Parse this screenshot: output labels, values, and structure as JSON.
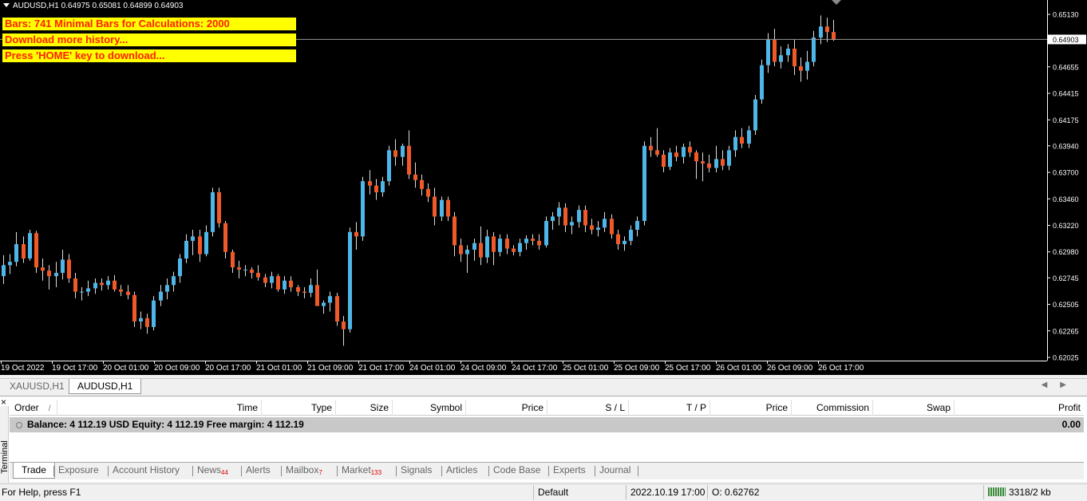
{
  "chart": {
    "symbol_line": "AUDUSD,H1  0.64975 0.65081 0.64899 0.64903",
    "warnings": [
      "Bars: 741   Minimal Bars for Calculations: 2000",
      "Download more history...",
      "Press 'HOME' key to download..."
    ],
    "current_price_label": "0.64903",
    "colors": {
      "background": "#000000",
      "bull": "#4fb6e8",
      "bear": "#f05a28",
      "text": "#ffffff",
      "warning_bg": "#ffff00",
      "warning_text": "#ff2000"
    }
  },
  "chart_data": {
    "type": "candlestick",
    "title": "",
    "price_ticks": [
      "0.65130",
      "0.64903",
      "0.64655",
      "0.64415",
      "0.64175",
      "0.63940",
      "0.63700",
      "0.63460",
      "0.63220",
      "0.62980",
      "0.62745",
      "0.62505",
      "0.62265",
      "0.62025"
    ],
    "time_ticks": [
      "19 Oct 2022",
      "19 Oct 17:00",
      "20 Oct 01:00",
      "20 Oct 09:00",
      "20 Oct 17:00",
      "21 Oct 01:00",
      "21 Oct 09:00",
      "21 Oct 17:00",
      "24 Oct 01:00",
      "24 Oct 09:00",
      "24 Oct 17:00",
      "25 Oct 01:00",
      "25 Oct 09:00",
      "25 Oct 17:00",
      "26 Oct 01:00",
      "26 Oct 09:00",
      "26 Oct 17:00"
    ],
    "ylim": [
      0.62025,
      0.652
    ],
    "candles": [
      [
        0.6276,
        0.6295,
        0.6269,
        0.6286
      ],
      [
        0.6286,
        0.6296,
        0.6278,
        0.6289
      ],
      [
        0.6289,
        0.6316,
        0.6285,
        0.6305
      ],
      [
        0.6305,
        0.6312,
        0.6288,
        0.6292
      ],
      [
        0.6292,
        0.6318,
        0.629,
        0.6315
      ],
      [
        0.6315,
        0.6317,
        0.6279,
        0.6284
      ],
      [
        0.6284,
        0.6292,
        0.6272,
        0.6281
      ],
      [
        0.6281,
        0.6286,
        0.6264,
        0.6276
      ],
      [
        0.6276,
        0.6289,
        0.6266,
        0.6279
      ],
      [
        0.6279,
        0.63,
        0.6273,
        0.6291
      ],
      [
        0.6291,
        0.6296,
        0.627,
        0.6274
      ],
      [
        0.6274,
        0.6279,
        0.6256,
        0.6262
      ],
      [
        0.6262,
        0.6266,
        0.6254,
        0.6262
      ],
      [
        0.6262,
        0.6272,
        0.6258,
        0.6265
      ],
      [
        0.6265,
        0.6274,
        0.626,
        0.627
      ],
      [
        0.627,
        0.6274,
        0.6263,
        0.6268
      ],
      [
        0.6268,
        0.6276,
        0.6264,
        0.6272
      ],
      [
        0.6272,
        0.6277,
        0.6262,
        0.6264
      ],
      [
        0.6264,
        0.6268,
        0.6258,
        0.6262
      ],
      [
        0.6262,
        0.6268,
        0.6255,
        0.6259
      ],
      [
        0.6259,
        0.6262,
        0.623,
        0.6235
      ],
      [
        0.6235,
        0.6244,
        0.6228,
        0.6238
      ],
      [
        0.6238,
        0.6242,
        0.6224,
        0.623
      ],
      [
        0.623,
        0.6258,
        0.6227,
        0.6254
      ],
      [
        0.6254,
        0.6268,
        0.6249,
        0.6262
      ],
      [
        0.6262,
        0.6274,
        0.6255,
        0.6268
      ],
      [
        0.6268,
        0.628,
        0.6262,
        0.6276
      ],
      [
        0.6276,
        0.6296,
        0.627,
        0.6292
      ],
      [
        0.6292,
        0.6314,
        0.6288,
        0.6308
      ],
      [
        0.6308,
        0.6318,
        0.6295,
        0.6312
      ],
      [
        0.6312,
        0.6318,
        0.6289,
        0.6296
      ],
      [
        0.6296,
        0.6322,
        0.6294,
        0.6316
      ],
      [
        0.6316,
        0.6356,
        0.6312,
        0.6352
      ],
      [
        0.6352,
        0.6356,
        0.632,
        0.6324
      ],
      [
        0.6324,
        0.6326,
        0.6292,
        0.6298
      ],
      [
        0.6298,
        0.63,
        0.6279,
        0.6284
      ],
      [
        0.6284,
        0.629,
        0.6274,
        0.6282
      ],
      [
        0.6282,
        0.6286,
        0.6276,
        0.6282
      ],
      [
        0.6282,
        0.6284,
        0.6274,
        0.6279
      ],
      [
        0.6279,
        0.6286,
        0.6272,
        0.6275
      ],
      [
        0.6275,
        0.6278,
        0.6266,
        0.627
      ],
      [
        0.627,
        0.628,
        0.6265,
        0.6276
      ],
      [
        0.6276,
        0.6278,
        0.6262,
        0.6264
      ],
      [
        0.6264,
        0.6276,
        0.626,
        0.6272
      ],
      [
        0.6272,
        0.6276,
        0.6262,
        0.6266
      ],
      [
        0.6266,
        0.6268,
        0.6258,
        0.6262
      ],
      [
        0.6262,
        0.6266,
        0.6256,
        0.6261
      ],
      [
        0.6261,
        0.6274,
        0.6257,
        0.6268
      ],
      [
        0.6268,
        0.6282,
        0.626,
        0.6249
      ],
      [
        0.6249,
        0.6254,
        0.6242,
        0.6252
      ],
      [
        0.6252,
        0.6262,
        0.6244,
        0.6258
      ],
      [
        0.6258,
        0.6261,
        0.6231,
        0.6235
      ],
      [
        0.6235,
        0.624,
        0.6213,
        0.6228
      ],
      [
        0.6228,
        0.632,
        0.6225,
        0.6316
      ],
      [
        0.6316,
        0.6325,
        0.63,
        0.6312
      ],
      [
        0.6312,
        0.6366,
        0.6308,
        0.6362
      ],
      [
        0.6362,
        0.6372,
        0.635,
        0.6358
      ],
      [
        0.6358,
        0.6364,
        0.6345,
        0.6352
      ],
      [
        0.6352,
        0.6366,
        0.6348,
        0.6362
      ],
      [
        0.6362,
        0.6394,
        0.6358,
        0.639
      ],
      [
        0.639,
        0.64,
        0.6376,
        0.6384
      ],
      [
        0.6384,
        0.6396,
        0.6376,
        0.6394
      ],
      [
        0.6394,
        0.6408,
        0.6364,
        0.6368
      ],
      [
        0.6368,
        0.6379,
        0.6356,
        0.6363
      ],
      [
        0.6363,
        0.6368,
        0.6349,
        0.6355
      ],
      [
        0.6355,
        0.636,
        0.6343,
        0.6348
      ],
      [
        0.6348,
        0.6356,
        0.6322,
        0.633
      ],
      [
        0.633,
        0.6348,
        0.6326,
        0.6345
      ],
      [
        0.6345,
        0.6348,
        0.6326,
        0.633
      ],
      [
        0.633,
        0.6334,
        0.6294,
        0.6304
      ],
      [
        0.6304,
        0.631,
        0.6289,
        0.6296
      ],
      [
        0.6296,
        0.6304,
        0.6279,
        0.63
      ],
      [
        0.63,
        0.631,
        0.629,
        0.6306
      ],
      [
        0.6306,
        0.6321,
        0.6286,
        0.6293
      ],
      [
        0.6293,
        0.6318,
        0.6288,
        0.6312
      ],
      [
        0.6312,
        0.6316,
        0.6286,
        0.6298
      ],
      [
        0.6298,
        0.6314,
        0.6294,
        0.631
      ],
      [
        0.631,
        0.6314,
        0.6296,
        0.6301
      ],
      [
        0.6301,
        0.6304,
        0.6295,
        0.6298
      ],
      [
        0.6298,
        0.631,
        0.6294,
        0.6306
      ],
      [
        0.6306,
        0.6313,
        0.63,
        0.631
      ],
      [
        0.631,
        0.6314,
        0.6304,
        0.6308
      ],
      [
        0.6308,
        0.6314,
        0.63,
        0.6304
      ],
      [
        0.6304,
        0.633,
        0.6302,
        0.6326
      ],
      [
        0.6326,
        0.6334,
        0.6318,
        0.633
      ],
      [
        0.633,
        0.6343,
        0.6322,
        0.6338
      ],
      [
        0.6338,
        0.6342,
        0.6316,
        0.6322
      ],
      [
        0.6322,
        0.633,
        0.6314,
        0.6325
      ],
      [
        0.6325,
        0.634,
        0.632,
        0.6336
      ],
      [
        0.6336,
        0.634,
        0.6316,
        0.6322
      ],
      [
        0.6322,
        0.6328,
        0.6314,
        0.6318
      ],
      [
        0.6318,
        0.6326,
        0.6312,
        0.632
      ],
      [
        0.632,
        0.6334,
        0.6316,
        0.6328
      ],
      [
        0.6328,
        0.6332,
        0.631,
        0.6314
      ],
      [
        0.6314,
        0.6318,
        0.63,
        0.6305
      ],
      [
        0.6305,
        0.6312,
        0.6299,
        0.6308
      ],
      [
        0.6308,
        0.6322,
        0.6304,
        0.6318
      ],
      [
        0.6318,
        0.633,
        0.6312,
        0.6326
      ],
      [
        0.6326,
        0.6398,
        0.6322,
        0.6394
      ],
      [
        0.6394,
        0.6402,
        0.6384,
        0.639
      ],
      [
        0.639,
        0.641,
        0.6384,
        0.6386
      ],
      [
        0.6386,
        0.639,
        0.637,
        0.6375
      ],
      [
        0.6375,
        0.6392,
        0.6372,
        0.6388
      ],
      [
        0.6388,
        0.6394,
        0.638,
        0.6384
      ],
      [
        0.6384,
        0.6396,
        0.6378,
        0.6393
      ],
      [
        0.6393,
        0.6398,
        0.6384,
        0.6388
      ],
      [
        0.6388,
        0.639,
        0.6364,
        0.638
      ],
      [
        0.638,
        0.6388,
        0.6362,
        0.6378
      ],
      [
        0.6378,
        0.6386,
        0.637,
        0.6374
      ],
      [
        0.6374,
        0.6394,
        0.637,
        0.6382
      ],
      [
        0.6382,
        0.639,
        0.6372,
        0.6376
      ],
      [
        0.6376,
        0.6394,
        0.6372,
        0.639
      ],
      [
        0.639,
        0.6408,
        0.6384,
        0.6402
      ],
      [
        0.6402,
        0.641,
        0.6392,
        0.6396
      ],
      [
        0.6396,
        0.6412,
        0.6392,
        0.6408
      ],
      [
        0.6408,
        0.644,
        0.6404,
        0.6436
      ],
      [
        0.6436,
        0.6472,
        0.6432,
        0.6467
      ],
      [
        0.6467,
        0.6496,
        0.646,
        0.649
      ],
      [
        0.649,
        0.65,
        0.6466,
        0.647
      ],
      [
        0.647,
        0.6484,
        0.6464,
        0.6476
      ],
      [
        0.6476,
        0.6486,
        0.647,
        0.6482
      ],
      [
        0.6482,
        0.649,
        0.6458,
        0.6466
      ],
      [
        0.6466,
        0.6474,
        0.6452,
        0.6462
      ],
      [
        0.6462,
        0.648,
        0.6454,
        0.647
      ],
      [
        0.647,
        0.6498,
        0.6466,
        0.6492
      ],
      [
        0.6492,
        0.6512,
        0.6486,
        0.6502
      ],
      [
        0.6502,
        0.651,
        0.6488,
        0.6497
      ],
      [
        0.6497,
        0.6508,
        0.6489,
        0.649
      ]
    ]
  },
  "tabs": {
    "symbols": [
      "XAUUSD,H1",
      "AUDUSD,H1"
    ],
    "scroll": [
      "◀",
      "▶"
    ]
  },
  "terminal": {
    "close": "×",
    "label": "Terminal",
    "columns": [
      "Order",
      "/",
      "Time",
      "Type",
      "Size",
      "Symbol",
      "Price",
      "S / L",
      "T / P",
      "Price",
      "Commission",
      "Swap",
      "Profit"
    ],
    "balance_text": "Balance: 4 112.19 USD  Equity: 4 112.19  Free margin: 4 112.19",
    "balance_profit": "0.00",
    "tabs": [
      {
        "label": "Trade",
        "badge": ""
      },
      {
        "label": "Exposure",
        "badge": ""
      },
      {
        "label": "Account History",
        "badge": ""
      },
      {
        "label": "News",
        "badge": "44"
      },
      {
        "label": "Alerts",
        "badge": ""
      },
      {
        "label": "Mailbox",
        "badge": "7"
      },
      {
        "label": "Market",
        "badge": "133"
      },
      {
        "label": "Signals",
        "badge": ""
      },
      {
        "label": "Articles",
        "badge": ""
      },
      {
        "label": "Code Base",
        "badge": ""
      },
      {
        "label": "Experts",
        "badge": ""
      },
      {
        "label": "Journal",
        "badge": ""
      }
    ]
  },
  "status": {
    "help": "For Help, press F1",
    "profile": "Default",
    "datetime": "2022.10.19 17:00",
    "open": "O: 0.62762",
    "traffic": "3318/2 kb"
  }
}
